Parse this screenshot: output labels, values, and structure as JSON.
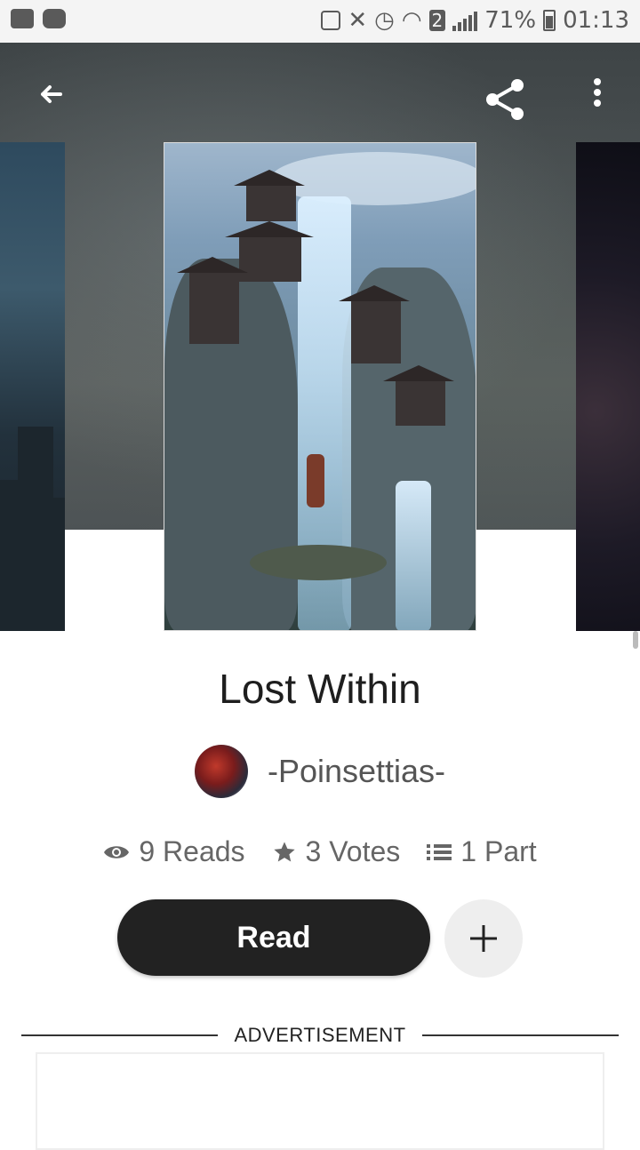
{
  "status_bar": {
    "battery_percent": "71%",
    "time": "01:13",
    "sim_badge": "2"
  },
  "toolbar": {
    "back_icon": "arrow-left-icon",
    "share_icon": "share-icon",
    "more_icon": "more-vertical-icon"
  },
  "story": {
    "title": "Lost Within",
    "author": "-Poinsettias-",
    "reads": "9 Reads",
    "votes": "3 Votes",
    "parts": "1 Part"
  },
  "actions": {
    "read_label": "Read",
    "add_icon": "plus-icon"
  },
  "advertisement": {
    "label": "ADVERTISEMENT"
  },
  "colors": {
    "read_button": "#222222",
    "add_button_bg": "#eeeeee",
    "stat_text": "#666666"
  }
}
